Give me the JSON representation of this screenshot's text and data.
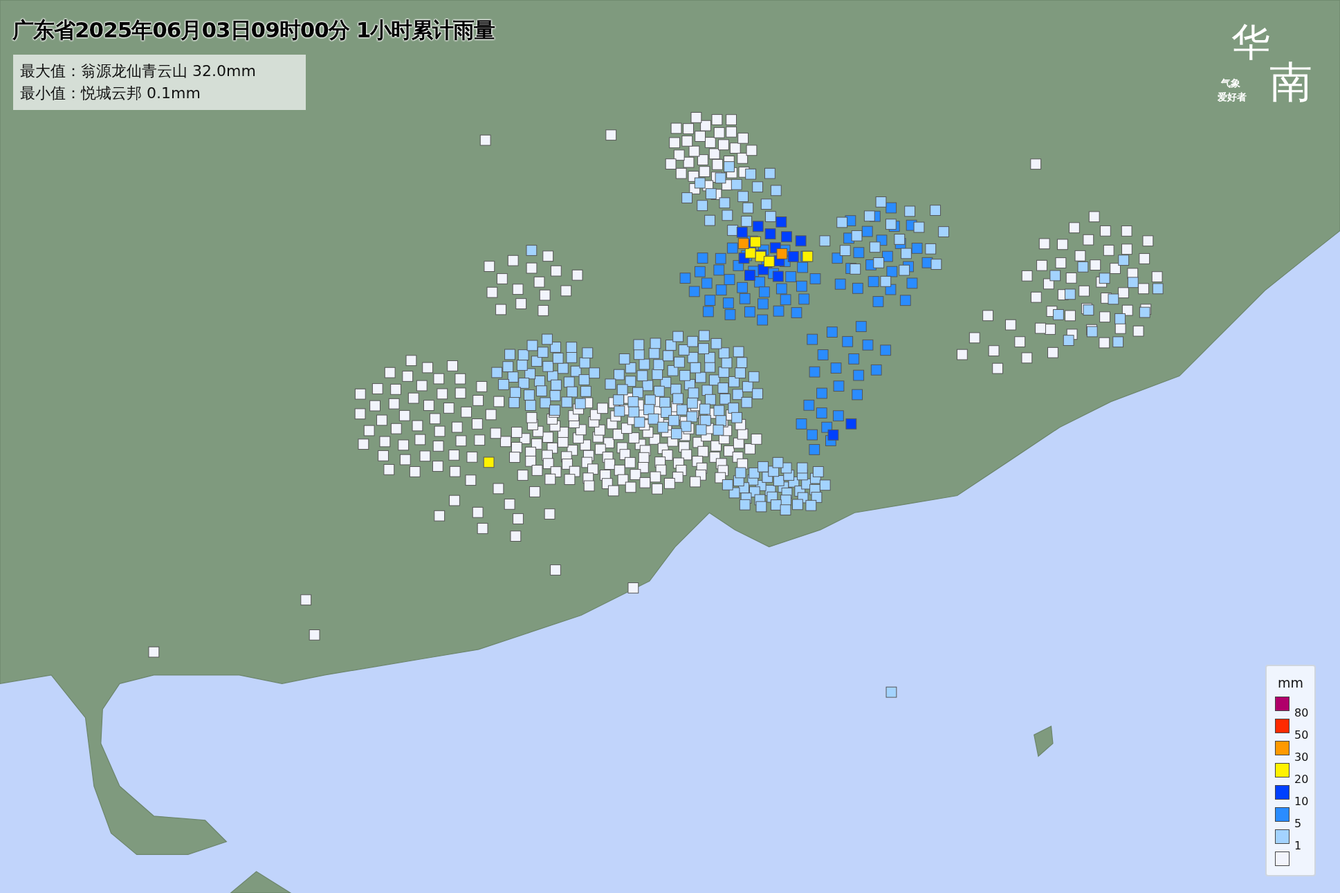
{
  "title": "广东省2025年06月03日09时00分 1小时累计雨量",
  "summary": [
    "最大值：翁源龙仙青云山 32.0mm",
    "最小值：悦城云邦 0.1mm"
  ],
  "logo": {
    "main": [
      "华",
      "南"
    ],
    "sub": [
      "气象",
      "爱好者"
    ]
  },
  "legend": {
    "unit": "mm",
    "swatches": [
      {
        "color": "#b0006a"
      },
      {
        "color": "#ff2a00"
      },
      {
        "color": "#ff9900"
      },
      {
        "color": "#fff200"
      },
      {
        "color": "#0040ff"
      },
      {
        "color": "#2a8cff"
      },
      {
        "color": "#a3d3ff"
      },
      {
        "color": "#f2f4fc"
      }
    ],
    "thresholds": [
      "80",
      "50",
      "30",
      "20",
      "10",
      "5",
      "1"
    ]
  }
}
